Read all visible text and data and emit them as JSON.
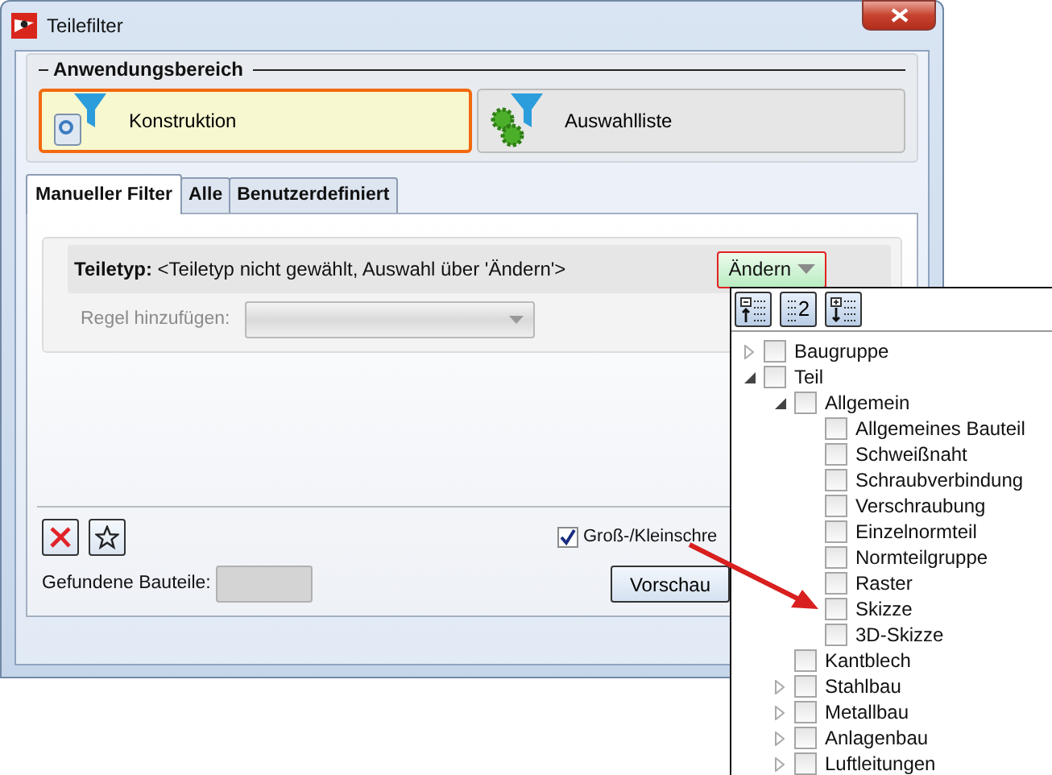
{
  "window": {
    "title": "Teilefilter"
  },
  "scope": {
    "title": "Anwendungsbereich",
    "options": [
      {
        "label": "Konstruktion",
        "kind": "design",
        "selected": true
      },
      {
        "label": "Auswahlliste",
        "kind": "selection",
        "selected": false
      }
    ]
  },
  "tabs": [
    {
      "label": "Manueller Filter",
      "selected": true
    },
    {
      "label": "Alle",
      "selected": false
    },
    {
      "label": "Benutzerdefiniert",
      "selected": false
    }
  ],
  "part_type": {
    "label": "Teiletyp:",
    "value": "<Teiletyp nicht gewählt, Auswahl über 'Ändern'>",
    "button": "Ändern"
  },
  "add_rule": {
    "label": "Regel hinzufügen:",
    "disabled": true
  },
  "case_sensitive": {
    "label": "Groß-/Kleinschre",
    "checked": true
  },
  "found": {
    "label": "Gefundene Bauteile:"
  },
  "preview_button": "Vorschau",
  "type_tree": {
    "toolbar": [
      {
        "kind": "collapse"
      },
      {
        "kind": "level",
        "label": "2"
      },
      {
        "kind": "expand"
      }
    ],
    "items": [
      {
        "label": "Baugruppe",
        "checked": false,
        "expanded": false
      },
      {
        "label": "Teil",
        "checked": false,
        "expanded": true,
        "children": [
          {
            "label": "Allgemein",
            "checked": false,
            "expanded": true,
            "children": [
              {
                "label": "Allgemeines Bauteil",
                "checked": false
              },
              {
                "label": "Schweißnaht",
                "checked": false
              },
              {
                "label": "Schraubverbindung",
                "checked": false
              },
              {
                "label": "Verschraubung",
                "checked": false
              },
              {
                "label": "Einzelnormteil",
                "checked": false
              },
              {
                "label": "Normteilgruppe",
                "checked": false
              },
              {
                "label": "Raster",
                "checked": false
              },
              {
                "label": "Skizze",
                "checked": false
              },
              {
                "label": "3D-Skizze",
                "checked": false
              }
            ]
          },
          {
            "label": "Kantblech",
            "checked": false
          },
          {
            "label": "Stahlbau",
            "checked": false,
            "expanded": false
          },
          {
            "label": "Metallbau",
            "checked": false,
            "expanded": false
          },
          {
            "label": "Anlagenbau",
            "checked": false,
            "expanded": false
          },
          {
            "label": "Luftleitungen",
            "checked": false,
            "expanded": false
          }
        ]
      }
    ]
  }
}
